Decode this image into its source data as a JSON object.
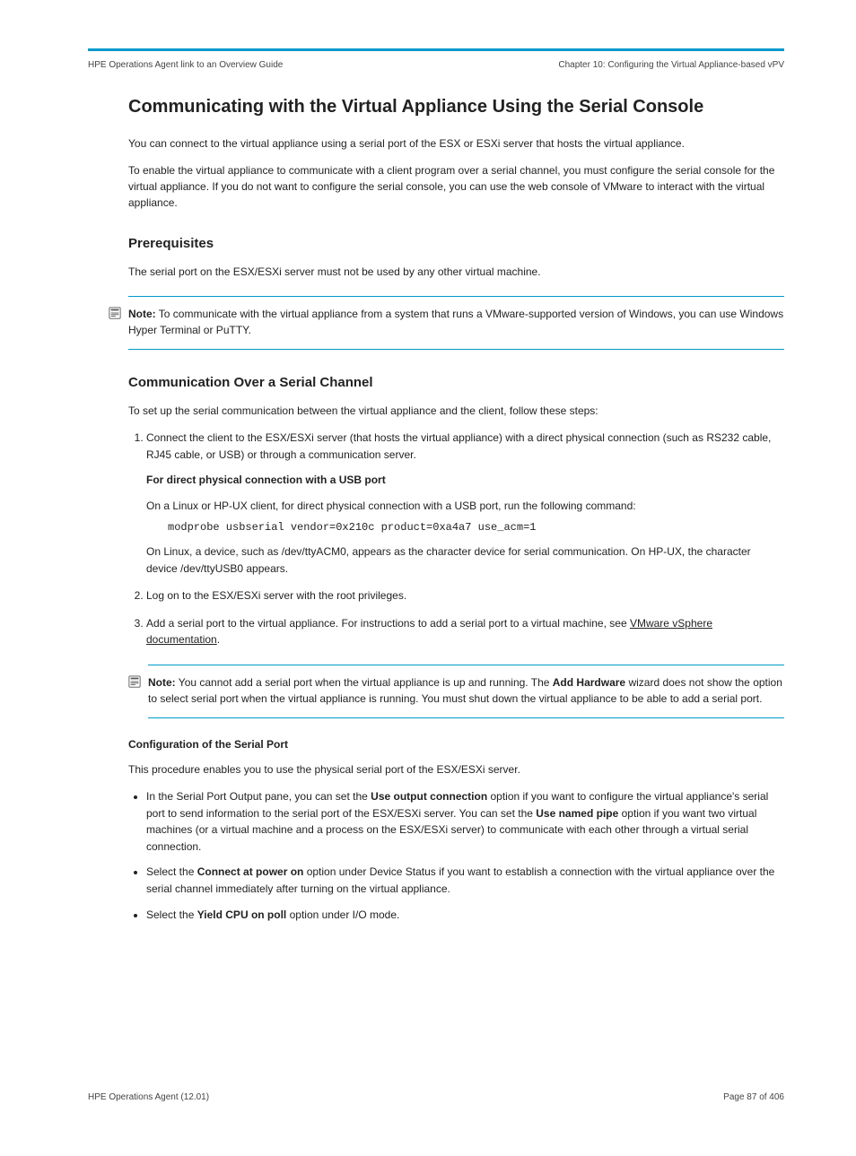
{
  "header": {
    "left": "HPE Operations Agent link to an Overview Guide",
    "right": "Chapter 10: Configuring the Virtual Appliance-based vPV"
  },
  "h1": "Communicating with the Virtual Appliance Using the Serial Console",
  "intro1": "You can connect to the virtual appliance using a serial port of the ESX or ESXi server that hosts the virtual appliance.",
  "intro2": "To enable the virtual appliance to communicate with a client program over a serial channel, you must configure the serial console for the virtual appliance. If you do not want to configure the serial console, you can use the web console of VMware to interact with the virtual appliance.",
  "h2_prereq": "Prerequisites",
  "prereq_text": "The serial port on the ESX/ESXi server must not be used by any other virtual machine.",
  "note1_label": "Note:",
  "note1_text": "To communicate with the virtual appliance from a system that runs a VMware-supported version of Windows, you can use Windows Hyper Terminal or PuTTY.",
  "h2_comm": "Communication Over a Serial Channel",
  "comm_p1": "To set up the serial communication between the virtual appliance and the client, follow these steps:",
  "steps": {
    "s1_a": "Connect the client to the ESX/ESXi server (that hosts the virtual appliance) with a direct physical connection (such as RS232 cable, RJ45 cable, or USB) or through a communication server.",
    "s1_b": "For direct physical connection with a USB port",
    "s1_c": "On a Linux or HP-UX client, for direct physical connection with a USB port, run the following command:",
    "s1_cmd": "modprobe usbserial vendor=0x210c product=0xa4a7 use_acm=1",
    "s1_d": "On Linux, a device, such as /dev/ttyACM0, appears as the character device for serial communication. On HP-UX, the character device /dev/ttyUSB0 appears.",
    "s2": "Log on to the ESX/ESXi server with the root privileges.",
    "s3_a": "Add a serial port to the virtual appliance. For instructions to add a serial port to a virtual machine, see ",
    "s3_link": "VMware vSphere documentation",
    "s3_b": "."
  },
  "note2_label": "Note:",
  "note2_a": "You cannot add a serial port when the virtual appliance is up and running. The ",
  "note2_b": "Add Hardware",
  "note2_c": " wizard does not show the option to select serial port when the virtual appliance is running. You must shut down the virtual appliance to be able to add a serial port.",
  "h3_config": "Configuration of the Serial Port",
  "config_intro": "This procedure enables you to use the physical serial port of the ESX/ESXi server.",
  "config_bullets": {
    "b1_a": "In the Serial Port Output pane, you can set the ",
    "b1_b": "Use output connection",
    "b1_c": " option if you want to configure the virtual appliance's serial port to send information to the serial port of the ESX/ESXi server. You can set the ",
    "b1_d": "Use named pipe",
    "b1_e": " option if you want two virtual machines (or a virtual machine and a process on the ESX/ESXi server) to communicate with each other through a virtual serial connection.",
    "b2_a": "Select the ",
    "b2_b": "Connect at power on",
    "b2_c": " option under Device Status if you want to establish a connection with the virtual appliance over the serial channel immediately after turning on the virtual appliance.",
    "b3_a": "Select the ",
    "b3_b": "Yield CPU on poll",
    "b3_c": " option under I/O mode."
  },
  "footer_left": "HPE Operations Agent (12.01)",
  "footer_right": "Page 87 of 406"
}
